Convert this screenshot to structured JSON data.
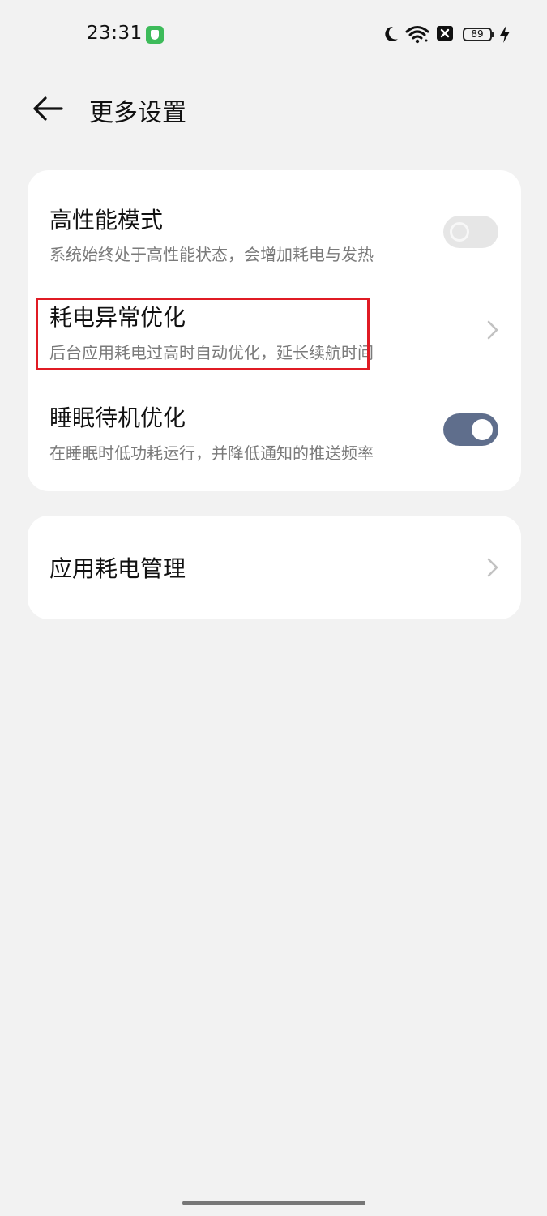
{
  "status_bar": {
    "time": "23:31",
    "battery": "89",
    "icons": [
      "app-notification-icon",
      "moon-icon",
      "wifi-icon",
      "sim-x-icon",
      "battery-icon",
      "charging-bolt-icon"
    ]
  },
  "header": {
    "title": "更多设置",
    "back_icon": "arrow-left-icon"
  },
  "settings": [
    {
      "title": "高性能模式",
      "subtitle": "系统始终处于高性能状态，会增加耗电与发热",
      "control": "toggle",
      "toggle_on": false
    },
    {
      "title": "耗电异常优化",
      "subtitle": "后台应用耗电过高时自动优化，延长续航时间",
      "control": "chevron"
    },
    {
      "title": "睡眠待机优化",
      "subtitle": "在睡眠时低功耗运行，并降低通知的推送频率",
      "control": "toggle",
      "toggle_on": true
    }
  ],
  "app_power": {
    "title": "应用耗电管理",
    "control": "chevron"
  },
  "colors": {
    "background": "#f2f2f2",
    "card": "#ffffff",
    "toggle_on": "#5f6e8c",
    "toggle_off": "#e6e6e6",
    "highlight": "#e01b24"
  }
}
